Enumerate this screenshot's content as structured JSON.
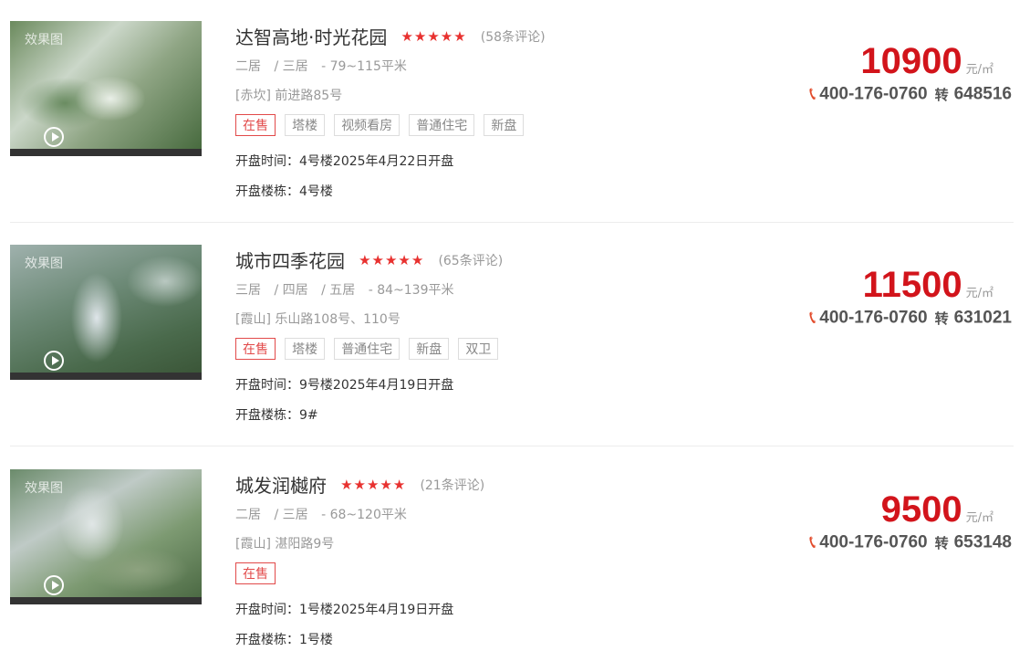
{
  "listings": [
    {
      "name": "达智高地·时光花园",
      "rating_stars": "★★★★★",
      "reviews": "(58条评论)",
      "layouts": [
        "二居",
        "/ 三居",
        "- 79~115平米"
      ],
      "address": "[赤坎] 前进路85号",
      "tags": [
        "在售",
        "塔楼",
        "视频看房",
        "普通住宅",
        "新盘"
      ],
      "open_time": "开盘时间：4号楼2025年4月22日开盘",
      "open_building": "开盘楼栋：4号楼",
      "price": "10900",
      "unit": "元/㎡",
      "phone": "400-176-0760",
      "ext_label": "转",
      "ext": "648516",
      "watermark": "效果图"
    },
    {
      "name": "城市四季花园",
      "rating_stars": "★★★★★",
      "reviews": "(65条评论)",
      "layouts": [
        "三居",
        "/ 四居",
        "/ 五居",
        "- 84~139平米"
      ],
      "address": "[霞山] 乐山路108号、110号",
      "tags": [
        "在售",
        "塔楼",
        "普通住宅",
        "新盘",
        "双卫"
      ],
      "open_time": "开盘时间：9号楼2025年4月19日开盘",
      "open_building": "开盘楼栋：9#",
      "price": "11500",
      "unit": "元/㎡",
      "phone": "400-176-0760",
      "ext_label": "转",
      "ext": "631021",
      "watermark": "效果图"
    },
    {
      "name": "城发润樾府",
      "rating_stars": "★★★★★",
      "reviews": "(21条评论)",
      "layouts": [
        "二居",
        "/ 三居",
        "- 68~120平米"
      ],
      "address": "[霞山] 湛阳路9号",
      "tags": [
        "在售"
      ],
      "open_time": "开盘时间：1号楼2025年4月19日开盘",
      "open_building": "开盘楼栋：1号楼",
      "price": "9500",
      "unit": "元/㎡",
      "phone": "400-176-0760",
      "ext_label": "转",
      "ext": "653148",
      "watermark": "效果图"
    }
  ],
  "icons": {
    "play": "play-icon",
    "phone": "phone-icon",
    "star": "star-icon"
  },
  "colors": {
    "price": "#d2141b",
    "stars": "#e8312f",
    "onsale": "#e24a4a",
    "phone_icon": "#e24a2a"
  }
}
